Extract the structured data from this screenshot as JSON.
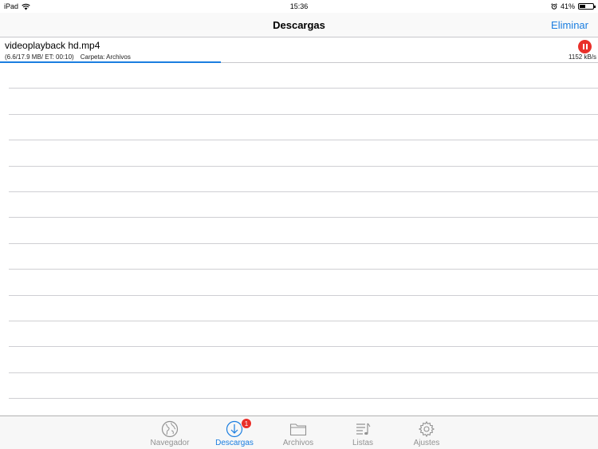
{
  "status_bar": {
    "device": "iPad",
    "time": "15:36",
    "battery_percent": "41%",
    "battery_level": 0.41
  },
  "nav": {
    "title": "Descargas",
    "action_label": "Eliminar"
  },
  "download": {
    "file_name": "videoplayback hd.mp4",
    "progress_text": "(6.6/17.9 MB/ ET: 00:10)",
    "folder_text": "Carpeta: Archivos",
    "speed": "1152 kB/s",
    "progress_fraction": 0.369
  },
  "tabs": [
    {
      "label": "Navegador",
      "icon": "globe-icon",
      "active": false
    },
    {
      "label": "Descargas",
      "icon": "download-icon",
      "active": true,
      "badge": "1"
    },
    {
      "label": "Archivos",
      "icon": "folder-icon",
      "active": false
    },
    {
      "label": "Listas",
      "icon": "playlist-icon",
      "active": false
    },
    {
      "label": "Ajustes",
      "icon": "gear-icon",
      "active": false
    }
  ],
  "colors": {
    "accent": "#1b7ee0",
    "pause_red": "#e9302a",
    "inactive_tab": "#929292"
  }
}
